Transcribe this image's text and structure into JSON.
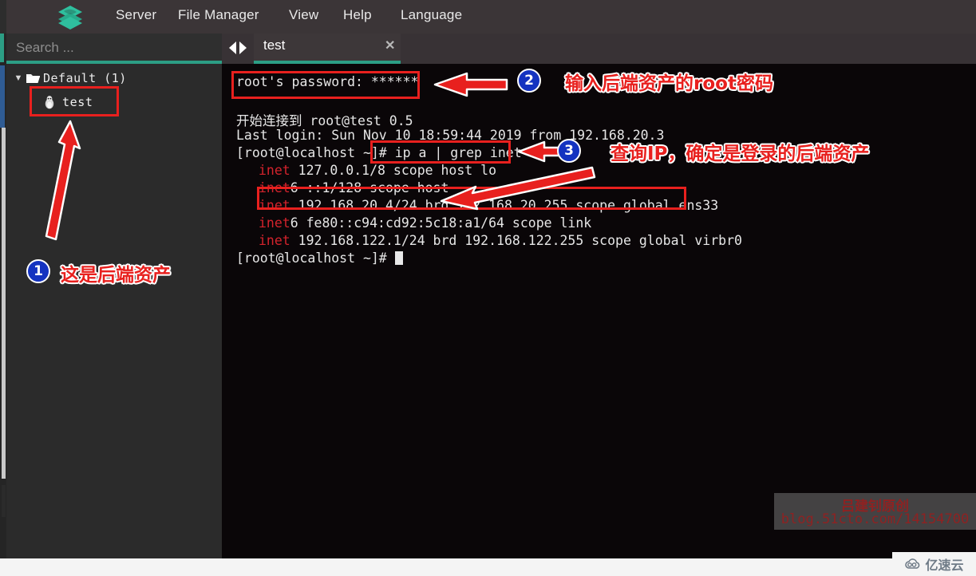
{
  "app": {
    "logo_icon": "layers-stack-icon",
    "menu": [
      {
        "id": "server",
        "label": "Server"
      },
      {
        "id": "file-manager",
        "label": "File Manager"
      },
      {
        "id": "view",
        "label": "View"
      },
      {
        "id": "help",
        "label": "Help"
      },
      {
        "id": "language",
        "label": "Language"
      }
    ]
  },
  "sidebar": {
    "search": {
      "placeholder": "Search ...",
      "value": "",
      "icon": "search-icon"
    },
    "tree": {
      "root": {
        "label": "Default (1)",
        "icon": "folder-open-icon",
        "chevron": "chevron-down-icon",
        "expanded": true
      },
      "children": [
        {
          "label": "test",
          "icon": "linux-penguin-icon",
          "selected": true
        }
      ]
    }
  },
  "tabbar": {
    "nav_icon": "left-right-arrows-icon",
    "tabs": [
      {
        "label": "test",
        "active": true,
        "close_icon": "close-icon"
      }
    ]
  },
  "terminal": {
    "lines": [
      {
        "id": "pw",
        "text": "root's password: ******"
      },
      {
        "id": "connect",
        "text": "开始连接到 root@test 0.5"
      },
      {
        "id": "lastlog",
        "text": "Last login: Sun Nov 10 18:59:44 2019 from 192.168.20.3"
      },
      {
        "id": "cmd",
        "prompt": "[root@localhost ~]# ",
        "text": "ip a | grep inet"
      },
      {
        "id": "inet-lo",
        "kw": "inet",
        "text": " 127.0.0.1/8 scope host lo"
      },
      {
        "id": "inet6-lo",
        "kw": "inet",
        "text": "6 ::1/128 scope host"
      },
      {
        "id": "inet-ens33",
        "kw": "inet",
        "text": " 192.168.20.4/24 brd 192.168.20.255 scope global ens33"
      },
      {
        "id": "inet6-link",
        "kw": "inet",
        "text": "6 fe80::c94:cd92:5c18:a1/64 scope link"
      },
      {
        "id": "inet-virbr",
        "kw": "inet",
        "text": " 192.168.122.1/24 brd 192.168.122.255 scope global virbr0"
      },
      {
        "id": "prompt-end",
        "text": "[root@localhost ~]# "
      }
    ]
  },
  "annotations": [
    {
      "id": "a1",
      "badge": "1",
      "text": "这是后端资产"
    },
    {
      "id": "a2",
      "badge": "2",
      "text": "输入后端资产的root密码"
    },
    {
      "id": "a3",
      "badge": "3",
      "text": "查询IP，确定是登录的后端资产"
    }
  ],
  "watermark": {
    "line1": "吕建钊原创",
    "line2": "blog.51cto.com/14154700"
  },
  "corner": {
    "label": "亿速云",
    "icon": "cloud-icon"
  },
  "colors": {
    "accent_teal": "#2c9e85",
    "annotation_red": "#e8201e",
    "badge_blue": "#1433c0",
    "terminal_bg": "#0a0608",
    "inet_keyword": "#d4232c"
  }
}
